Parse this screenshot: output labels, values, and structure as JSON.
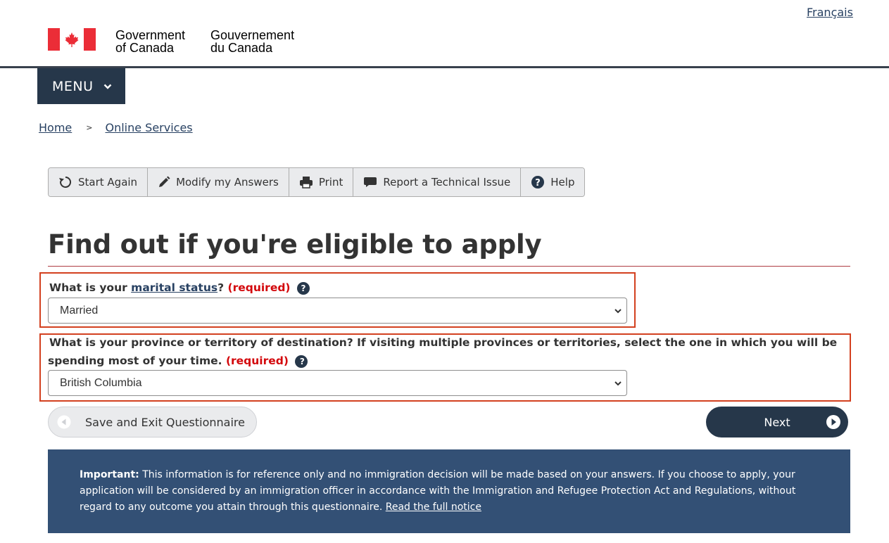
{
  "header": {
    "language_link": "Français",
    "signature_en_line1": "Government",
    "signature_en_line2": "of Canada",
    "signature_fr_line1": "Gouvernement",
    "signature_fr_line2": "du Canada"
  },
  "menu": {
    "label": "MENU"
  },
  "breadcrumb": {
    "items": [
      "Home",
      "Online Services"
    ],
    "separator": ">"
  },
  "toolbar": {
    "start_again": "Start Again",
    "modify": "Modify my Answers",
    "print": "Print",
    "report": "Report a Technical Issue",
    "help": "Help"
  },
  "page": {
    "title": "Find out if you're eligible to apply"
  },
  "questions": {
    "marital": {
      "prefix": "What is your ",
      "link": "marital status",
      "suffix": "?",
      "required": "(required)",
      "selected": "Married"
    },
    "province": {
      "text": "What is your province or territory of destination? If visiting multiple provinces or territories, select the one in which you will be spending most of your time.",
      "required": "(required)",
      "selected": "British Columbia"
    }
  },
  "buttons": {
    "save_exit": "Save and Exit Questionnaire",
    "next": "Next"
  },
  "notice": {
    "label": "Important:",
    "text": "This information is for reference only and no immigration decision will be made based on your answers. If you choose to apply, your application will be considered by an immigration officer in accordance with the Immigration and Refugee Protection Act and Regulations, without regard to any outcome you attain through this questionnaire.",
    "link": "Read the full notice"
  },
  "colors": {
    "header_navy": "#26374a",
    "highlight_border": "#d3401f",
    "required_red": "#d3080c",
    "notice_bg": "#335075",
    "flag_red": "#eb2d37"
  }
}
